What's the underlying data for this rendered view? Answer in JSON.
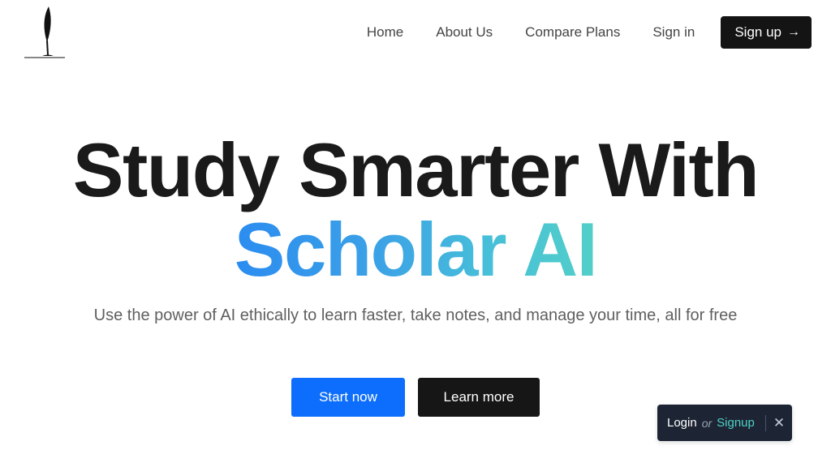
{
  "nav": {
    "home": "Home",
    "about": "About Us",
    "compare": "Compare Plans",
    "signin": "Sign in",
    "signup": "Sign up",
    "signup_arrow": "→"
  },
  "hero": {
    "line1": "Study Smarter With",
    "line2": "Scholar AI",
    "subtitle": "Use the power of AI ethically to learn faster, take notes, and manage your time, all for free"
  },
  "buttons": {
    "start": "Start now",
    "learn": "Learn more"
  },
  "toast": {
    "login": "Login",
    "or": "or",
    "signup": "Signup",
    "close": "✕"
  },
  "colors": {
    "primary": "#0d6efd",
    "dark": "#141414",
    "gradient_start": "#2b8cf0",
    "gradient_end": "#52cfc8",
    "toast_bg": "#1d2535",
    "toast_accent": "#4fd1c5"
  },
  "icons": {
    "logo": "quill-pen-icon",
    "arrow": "arrow-right-icon",
    "close": "close-icon"
  }
}
